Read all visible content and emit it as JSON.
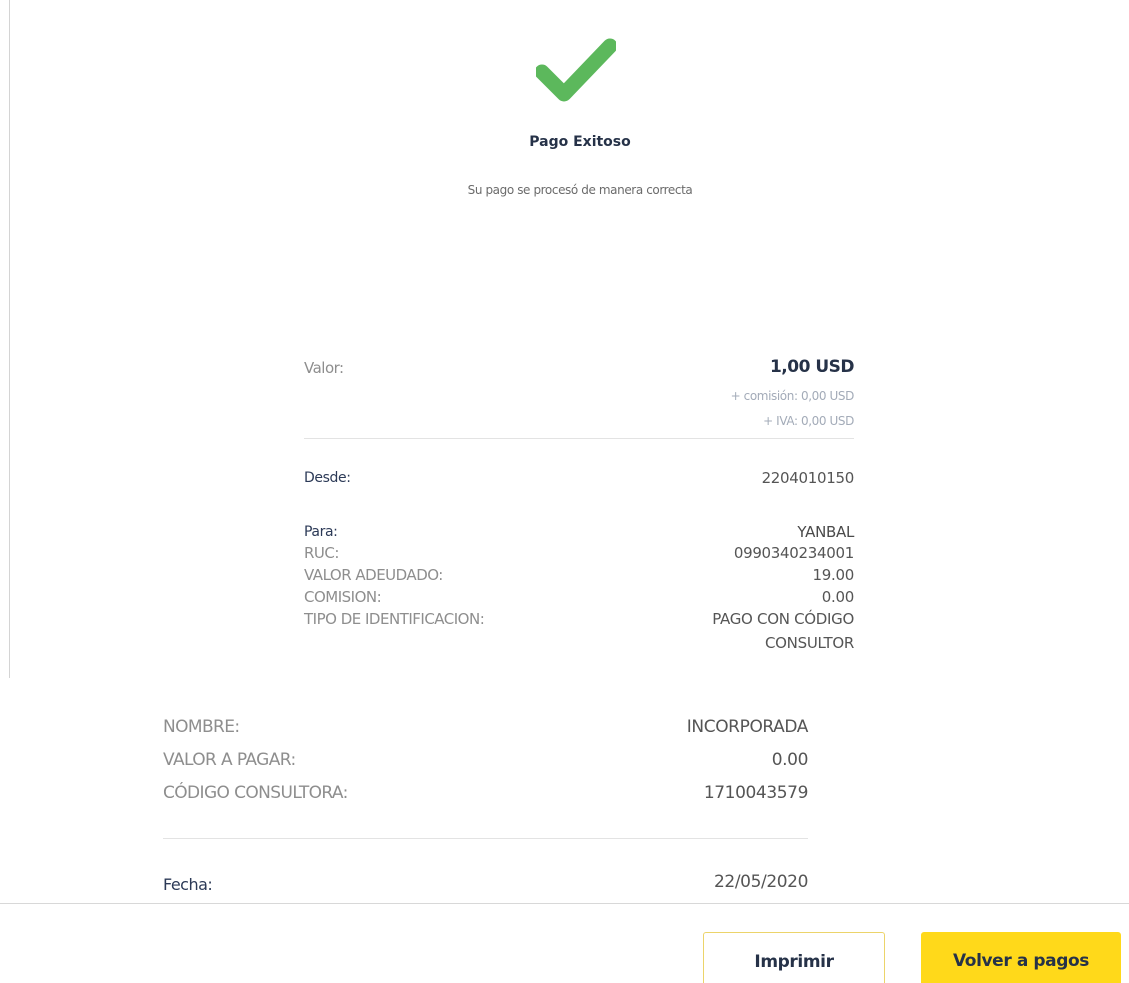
{
  "colors": {
    "success": "#5cb85c",
    "accent": "#ffd91a",
    "navy": "#263248"
  },
  "header": {
    "icon": "check-icon",
    "title": "Pago Exitoso",
    "subtitle": "Su pago se procesó de manera correcta"
  },
  "summary": {
    "amount_label": "Valor:",
    "amount": "1,00 USD",
    "commission": "+ comisión: 0,00 USD",
    "iva": "+ IVA: 0,00 USD"
  },
  "from": {
    "label": "Desde:",
    "value": "2204010150"
  },
  "to": {
    "label": "Para:",
    "value": "YANBAL",
    "details": [
      {
        "label": "RUC:",
        "value": "0990340234001"
      },
      {
        "label": "VALOR ADEUDADO:",
        "value": "19.00"
      },
      {
        "label": "COMISION:",
        "value": "0.00"
      },
      {
        "label": "TIPO DE IDENTIFICACION:",
        "value_line1": "PAGO CON CÓDIGO",
        "value_line2": "CONSULTOR"
      }
    ]
  },
  "extra": [
    {
      "label": "NOMBRE:",
      "value": "INCORPORADA"
    },
    {
      "label": "VALOR A PAGAR:",
      "value": "0.00"
    },
    {
      "label": "CÓDIGO CONSULTORA:",
      "value": "1710043579"
    }
  ],
  "date": {
    "label": "Fecha:",
    "value": "22/05/2020"
  },
  "actions": {
    "print_label": "Imprimir",
    "back_label": "Volver a pagos"
  }
}
